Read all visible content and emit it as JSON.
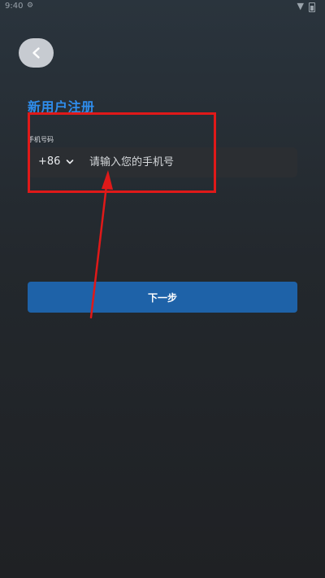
{
  "status_bar": {
    "time": "9:40",
    "settings_icon": "gear-icon",
    "wifi_icon": "wifi-icon",
    "battery_icon": "battery-icon"
  },
  "header": {
    "back_icon": "chevron-left-icon",
    "title": "新用户注册"
  },
  "form": {
    "phone_label": "手机号码",
    "country_code": "+86",
    "country_code_icon": "chevron-down-icon",
    "phone_placeholder": "请输入您的手机号",
    "phone_value": ""
  },
  "actions": {
    "next_label": "下一步"
  },
  "annotation": {
    "highlight_color": "#e01919",
    "arrow_color": "#e01919"
  },
  "colors": {
    "accent": "#2f8dec",
    "button": "#1e62a8",
    "field_bg": "#2b2e32"
  }
}
